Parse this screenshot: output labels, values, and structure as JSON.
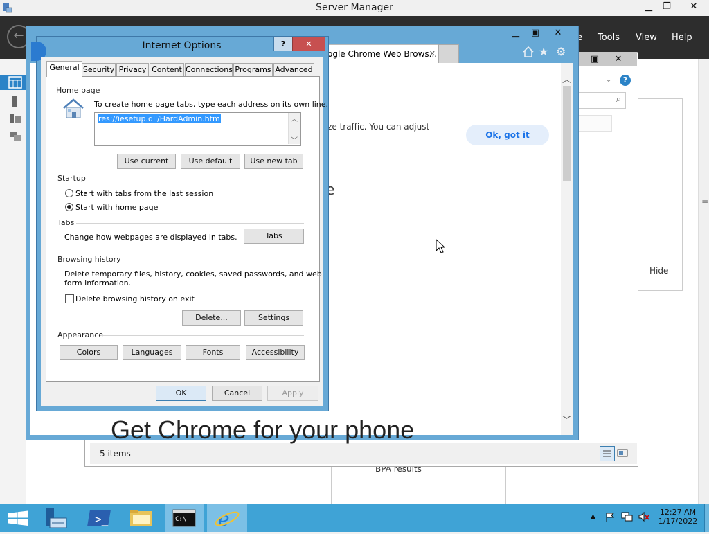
{
  "server_manager": {
    "title": "Server Manager",
    "menu": [
      "Tools",
      "View",
      "Help"
    ],
    "partial_menu": "e",
    "hide_label": "Hide",
    "bpa_label": "BPA results",
    "items_count": "5 items"
  },
  "ie": {
    "tab_title": "ogle Chrome Web Brows...",
    "tab_close": "✕",
    "banner_text": "yze traffic. You can adjust",
    "ok_button": "Ok, got it",
    "heading_fragment": "e",
    "phone_heading": "Get Chrome for your phone"
  },
  "internet_options": {
    "title": "Internet Options",
    "help_button": "?",
    "close_button": "✕",
    "tabs": [
      "General",
      "Security",
      "Privacy",
      "Content",
      "Connections",
      "Programs",
      "Advanced"
    ],
    "selected_tab": "General",
    "home_page": {
      "group_label": "Home page",
      "instruction": "To create home page tabs, type each address on its own line.",
      "url_value": "res://iesetup.dll/HardAdmin.htm",
      "buttons": [
        "Use current",
        "Use default",
        "Use new tab"
      ]
    },
    "startup": {
      "group_label": "Startup",
      "option_last_session": "Start with tabs from the last session",
      "option_home_page": "Start with home page",
      "selected": "Start with home page"
    },
    "tabs_group": {
      "group_label": "Tabs",
      "description": "Change how webpages are displayed in tabs.",
      "button": "Tabs"
    },
    "browsing_history": {
      "group_label": "Browsing history",
      "description_line1": "Delete temporary files, history, cookies, saved passwords, and web",
      "description_line2": "form information.",
      "checkbox_label": "Delete browsing history on exit",
      "checkbox_checked": false,
      "delete_button": "Delete...",
      "settings_button": "Settings"
    },
    "appearance": {
      "group_label": "Appearance",
      "buttons": [
        "Colors",
        "Languages",
        "Fonts",
        "Accessibility"
      ]
    },
    "footer": {
      "ok": "OK",
      "cancel": "Cancel",
      "apply": "Apply"
    }
  },
  "taskbar": {
    "time": "12:27 AM",
    "date": "1/17/2022",
    "tray_expand": "▲"
  },
  "icons": {
    "minimize": "▬",
    "maximize": "▢",
    "close": "✕",
    "back": "←",
    "search": "⌕",
    "help": "?",
    "scroll_up": "︿",
    "scroll_down": "﹀"
  },
  "colors": {
    "dialog_frame": "#67a9d6",
    "taskbar": "#3fa3d6",
    "selection": "#3399ff",
    "close_red": "#c75050",
    "sm_header": "#2d2d2d"
  }
}
